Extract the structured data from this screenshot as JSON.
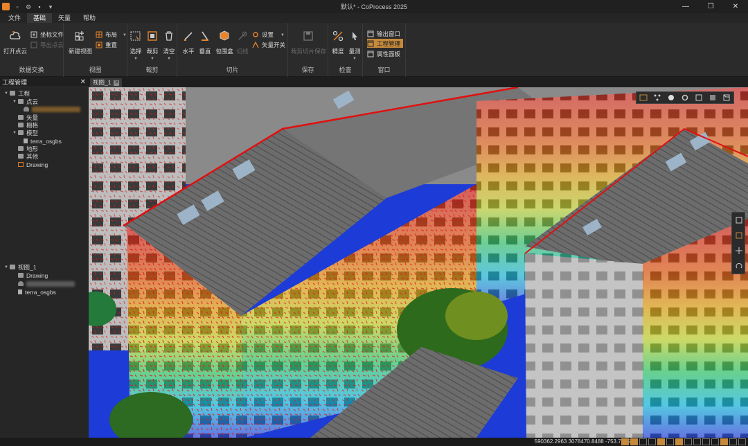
{
  "window": {
    "title": "默认* - CoProcess 2025"
  },
  "menu": [
    "文件",
    "基础",
    "矢量",
    "帮助"
  ],
  "ribbon": {
    "data_exchange": {
      "label": "数据交换",
      "open_cloud": "打开点云",
      "coord_file": "坐标文件",
      "export_cloud": "导出点云"
    },
    "view": {
      "label": "视图",
      "new_view": "新建视图",
      "layout": "布局",
      "reset": "重置"
    },
    "crop": {
      "label": "裁剪",
      "select": "选择",
      "crop": "裁剪",
      "clear": "清空"
    },
    "slice": {
      "label": "切片",
      "horizontal": "水平",
      "vertical": "垂直",
      "bbox": "包围盒",
      "cut": "切线",
      "settings": "设置",
      "vector_switch": "矢量开关"
    },
    "save": {
      "label": "保存",
      "save_slice": "裁剪切片保存"
    },
    "check": {
      "label": "检查",
      "precision": "精度",
      "measure": "量测"
    },
    "window": {
      "label": "窗口",
      "output_window": "输出窗口",
      "project_manager": "工程管理",
      "property_panel": "属性面板"
    }
  },
  "panel": {
    "title": "工程管理",
    "tree": {
      "project": "工程",
      "point_cloud": "点云",
      "vector": "矢量",
      "raster": "栅格",
      "model": "模型",
      "model_child": "terra_osgbs",
      "terrain": "地形",
      "other": "其他",
      "drawing": "Drawing",
      "view": "视图_1",
      "view_drawing": "Drawing",
      "view_model": "terra_osgbs"
    }
  },
  "tab": {
    "label": "视图_1"
  },
  "status": {
    "coords": "590362.2963 3078470.8488 -753.7015"
  },
  "colors": {
    "accent": "#c58a3c",
    "bg": "#1f1f1f"
  }
}
